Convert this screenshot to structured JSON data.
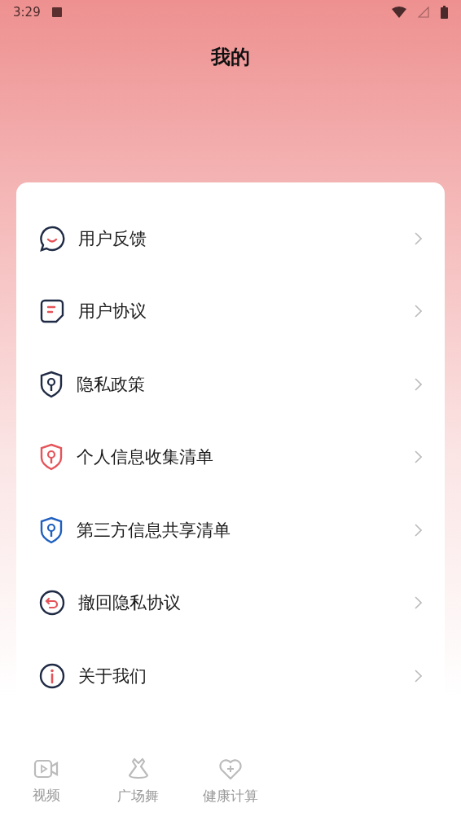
{
  "status_bar": {
    "time": "3:29"
  },
  "title": "我的",
  "menu": [
    {
      "kind": "feedback",
      "label": "用户反馈"
    },
    {
      "kind": "agreement",
      "label": "用户协议"
    },
    {
      "kind": "shield",
      "label": "隐私政策",
      "color": "#1f2a44"
    },
    {
      "kind": "shield",
      "label": "个人信息收集清单",
      "color": "#e5545a"
    },
    {
      "kind": "shield",
      "label": "第三方信息共享清单",
      "color": "#1f5fbf"
    },
    {
      "kind": "revoke",
      "label": "撤回隐私协议"
    },
    {
      "kind": "info",
      "label": "关于我们"
    }
  ],
  "nav": [
    {
      "kind": "video",
      "label": "视频",
      "selected": false
    },
    {
      "kind": "dance",
      "label": "广场舞",
      "selected": false
    },
    {
      "kind": "health",
      "label": "健康计算",
      "selected": false
    }
  ]
}
